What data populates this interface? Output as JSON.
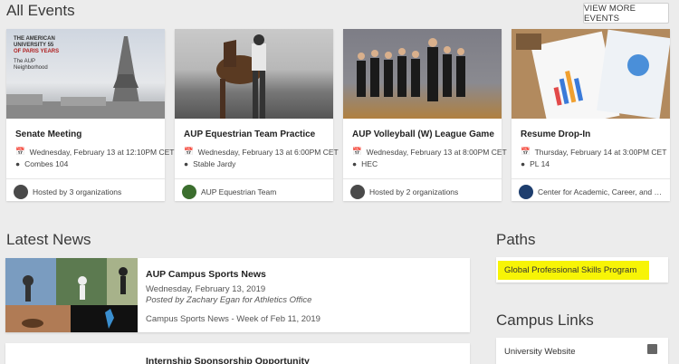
{
  "sections": {
    "events": "All Events",
    "news": "Latest News",
    "paths": "Paths",
    "links": "Campus Links"
  },
  "view_more": "VIEW MORE EVENTS",
  "events": [
    {
      "title": "Senate Meeting",
      "time": "Wednesday, February 13 at 12:10PM CET",
      "location": "Combes 104",
      "host": "Hosted by 3 organizations",
      "banner": [
        "THE AMERICAN",
        "UNIVERSITY 55",
        "OF PARIS YEARS",
        "The AUP",
        "Neighborhood"
      ]
    },
    {
      "title": "AUP Equestrian Team Practice",
      "time": "Wednesday, February 13 at 6:00PM CET",
      "location": "Stable Jardy",
      "host": "AUP Equestrian Team"
    },
    {
      "title": "AUP Volleyball (W) League Game",
      "time": "Wednesday, February 13 at 8:00PM CET",
      "location": "HEC",
      "host": "Hosted by 2 organizations"
    },
    {
      "title": "Resume Drop-In",
      "time": "Thursday, February 14 at 3:00PM CET",
      "location": "PL 14",
      "host": "Center for Academic, Career, and Ex..."
    }
  ],
  "news": [
    {
      "title": "AUP Campus Sports News",
      "date": "Wednesday, February 13, 2019",
      "byline": "Posted by Zachary Egan for Athletics Office",
      "summary": "Campus Sports News - Week of Feb 11, 2019"
    },
    {
      "title": "Internship Sponsorship Opportunity"
    }
  ],
  "paths": [
    "Global Professional Skills Program"
  ],
  "links": [
    "University Website"
  ],
  "colors": {
    "highlight": "#f7f406",
    "background": "#ececec"
  }
}
